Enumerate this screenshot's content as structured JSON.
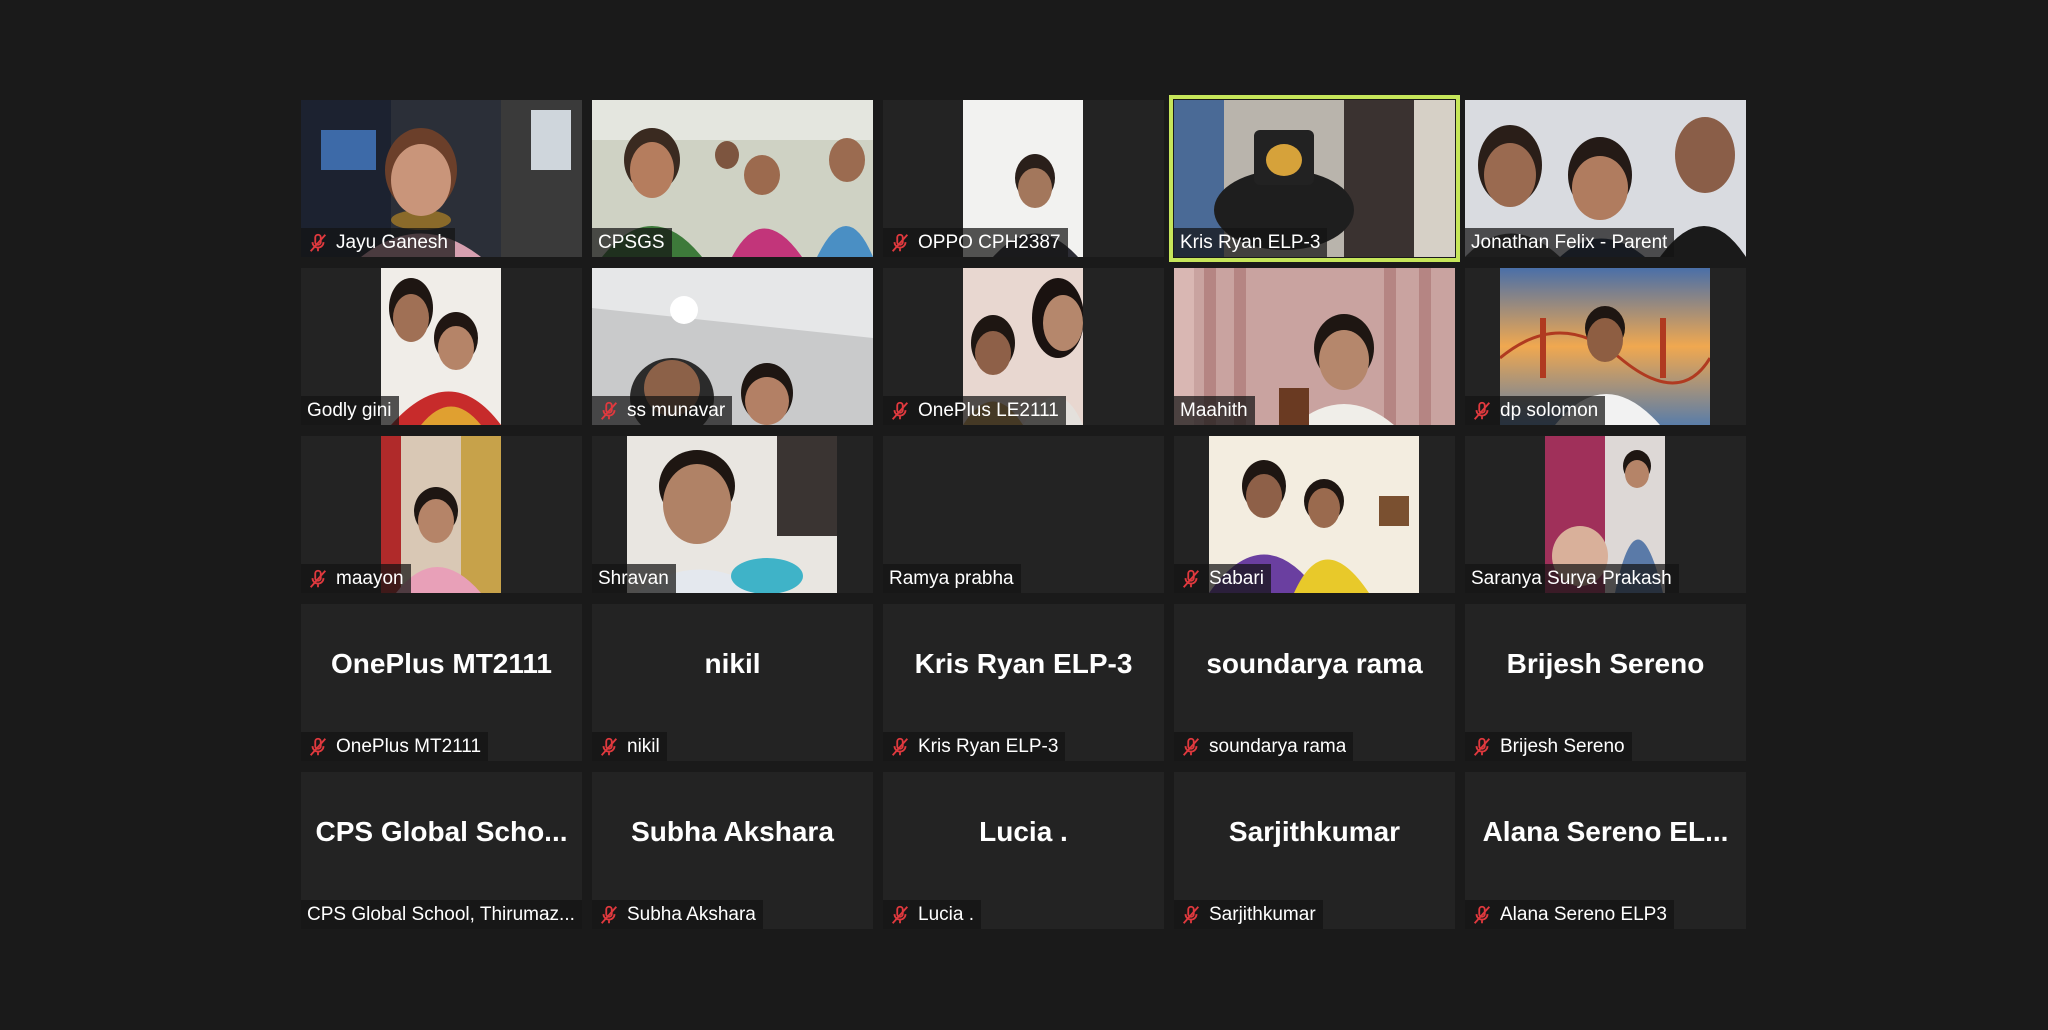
{
  "accent_speaker_color": "#c6e65a",
  "mute_icon_color": "#e0393e",
  "participants": [
    {
      "name": "Jayu Ganesh",
      "muted": true,
      "video": true
    },
    {
      "name": "CPSGS",
      "muted": false,
      "video": true
    },
    {
      "name": "OPPO CPH2387",
      "muted": true,
      "video": true
    },
    {
      "name": "Kris Ryan ELP-3",
      "muted": false,
      "video": true,
      "active_speaker": true
    },
    {
      "name": "Jonathan Felix - Parent",
      "muted": false,
      "video": true
    },
    {
      "name": "Godly gini",
      "muted": false,
      "video": true
    },
    {
      "name": "ss munavar",
      "muted": true,
      "video": true
    },
    {
      "name": "OnePlus LE2111",
      "muted": true,
      "video": true
    },
    {
      "name": "Maahith",
      "muted": false,
      "video": true
    },
    {
      "name": "dp solomon",
      "muted": true,
      "video": true
    },
    {
      "name": "maayon",
      "muted": true,
      "video": true
    },
    {
      "name": "Shravan",
      "muted": false,
      "video": true
    },
    {
      "name": "Ramya prabha",
      "muted": false,
      "video": false,
      "display_name": ""
    },
    {
      "name": "Sabari",
      "muted": true,
      "video": true
    },
    {
      "name": "Saranya Surya Prakash",
      "muted": false,
      "video": true
    },
    {
      "name": "OnePlus MT2111",
      "muted": true,
      "video": false,
      "display_name": "OnePlus MT2111"
    },
    {
      "name": "nikil",
      "muted": true,
      "video": false,
      "display_name": "nikil"
    },
    {
      "name": "Kris Ryan ELP-3",
      "muted": true,
      "video": false,
      "display_name": "Kris Ryan ELP-3"
    },
    {
      "name": "soundarya rama",
      "muted": true,
      "video": false,
      "display_name": "soundarya rama"
    },
    {
      "name": "Brijesh Sereno",
      "muted": true,
      "video": false,
      "display_name": "Brijesh Sereno"
    },
    {
      "name": "CPS Global School, Thirumaz...",
      "muted": false,
      "video": false,
      "display_name": "CPS Global Scho..."
    },
    {
      "name": "Subha Akshara",
      "muted": true,
      "video": false,
      "display_name": "Subha Akshara"
    },
    {
      "name": "Lucia .",
      "muted": true,
      "video": false,
      "display_name": "Lucia ."
    },
    {
      "name": "Sarjithkumar",
      "muted": true,
      "video": false,
      "display_name": "Sarjithkumar"
    },
    {
      "name": "Alana Sereno ELP3",
      "muted": true,
      "video": false,
      "display_name": "Alana Sereno EL..."
    }
  ]
}
